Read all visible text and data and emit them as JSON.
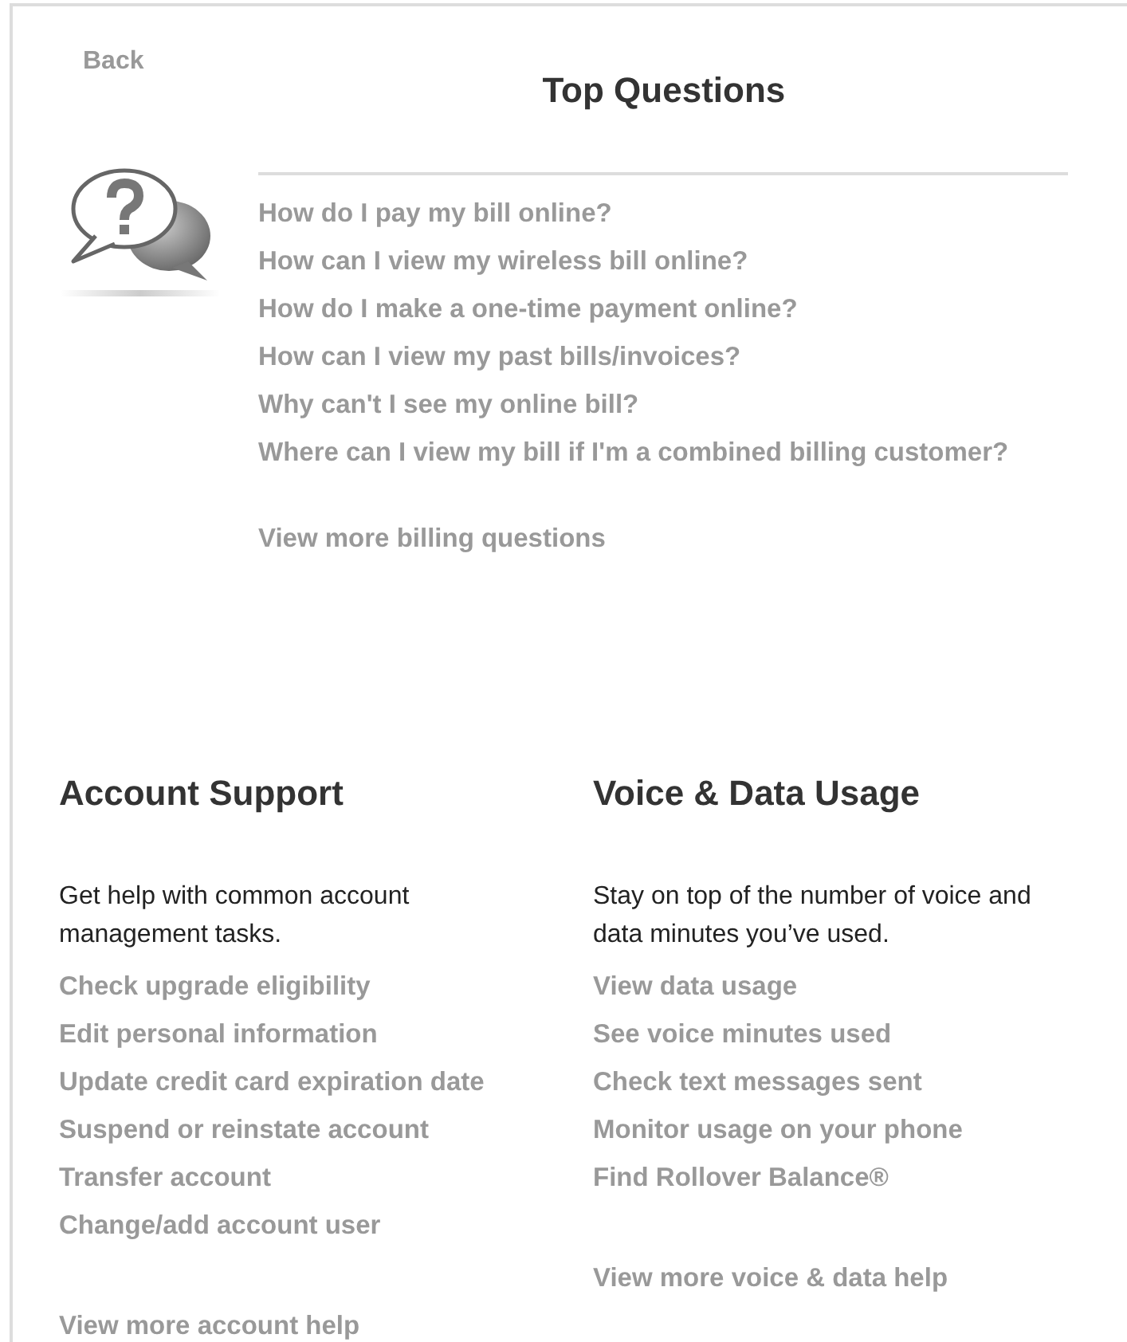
{
  "back": "Back",
  "title": "Top Questions",
  "questions": [
    "How do I pay my bill online?",
    "How can I view my wireless bill online?",
    "How do I make a one-time payment online?",
    "How can I view my past bills/invoices?",
    "Why can't I see my online bill?",
    "Where can I view my bill if I'm a combined billing customer?"
  ],
  "questions_more": "View more billing questions",
  "sections": [
    {
      "heading": "Account Support",
      "description": "Get help with common account management tasks.",
      "links": [
        "Check upgrade eligibility",
        "Edit personal information",
        "Update credit card expiration date",
        "Suspend or reinstate account",
        "Transfer account",
        "Change/add account user"
      ],
      "more": "View more account help"
    },
    {
      "heading": "Voice & Data Usage",
      "description": "Stay on top of the number of voice and data minutes you’ve used.",
      "links": [
        "View data usage",
        "See voice minutes used",
        "Check text messages sent",
        "Monitor usage on your phone",
        "Find Rollover Balance®"
      ],
      "more": "View more voice & data help"
    }
  ]
}
